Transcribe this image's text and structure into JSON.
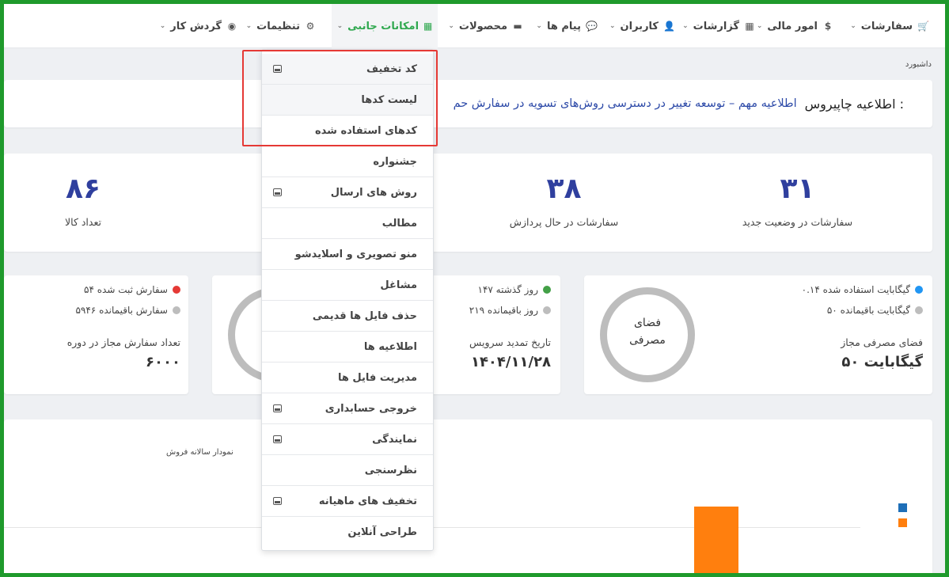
{
  "nav": {
    "items": [
      {
        "label": "سفارشات",
        "icon": "cart-icon",
        "glyph": "🛒"
      },
      {
        "label": "امور مالی",
        "icon": "dollar-icon",
        "glyph": "$"
      },
      {
        "label": "گزارشات",
        "icon": "bar-chart-icon",
        "glyph": "▦"
      },
      {
        "label": "کاربران",
        "icon": "user-icon",
        "glyph": "👤"
      },
      {
        "label": "پیام ها",
        "icon": "message-icon",
        "glyph": "💬"
      },
      {
        "label": "محصولات",
        "icon": "store-icon",
        "glyph": "▬"
      },
      {
        "label": "امکانات جانبی",
        "icon": "grid-icon",
        "glyph": "▦"
      },
      {
        "label": "تنظیمات",
        "icon": "gear-icon",
        "glyph": "⚙"
      },
      {
        "label": "گردش کار",
        "icon": "workflow-icon",
        "glyph": "◉"
      }
    ],
    "chevron": "⌄",
    "active_index": 6
  },
  "breadcrumb": "داشبورد",
  "announcement": {
    "label": "اطلاعیه چاپیروس :",
    "link": "اطلاعیه مهم – توسعه تغییر در دسترسی روش‌های تسویه در سفارش حم"
  },
  "stats": [
    {
      "value": "۳۱",
      "label": "سفارشات در وضعیت جدید"
    },
    {
      "value": "۳۸",
      "label": "سفارشات در حال پردازش"
    },
    {
      "value": "۸۶",
      "label": "تعداد کالا"
    }
  ],
  "storage": {
    "used": "۰.۱۴ گیگابایت استفاده شده",
    "remaining": "۵۰ گیگابایت باقیمانده",
    "allowed_label": "فضای مصرفی مجاز",
    "allowed_value": "۵۰ گیگابایت",
    "ring_line1": "فضای",
    "ring_line2": "مصرفی",
    "used_color": "#2196f3",
    "remaining_color": "#bdbdbd"
  },
  "service": {
    "passed": "۱۴۷ روز گذشته",
    "remaining": "۲۱۹ روز باقیمانده",
    "renew_label": "تاریخ تمدید سرویس",
    "renew_value": "۱۴۰۴/۱۱/۲۸",
    "passed_color": "#43a047"
  },
  "orders_quota": {
    "registered": "۵۴ سفارش ثبت شده",
    "remaining": "۵۹۴۶ سفارش باقیمانده",
    "allowed_label": "تعداد سفارش مجاز در دوره",
    "allowed_value": "۶۰۰۰",
    "registered_color": "#e53935"
  },
  "chart": {
    "title": "نمودار سالانه فروش",
    "series_colors": [
      "#1e6fb8",
      "#ff7f0e"
    ]
  },
  "dropdown": {
    "items": [
      {
        "label": "کد تخفیف",
        "icon": true,
        "shaded": true
      },
      {
        "label": "لیست کدها",
        "icon": false,
        "shaded": true
      },
      {
        "label": "کدهای استفاده شده",
        "icon": false,
        "shaded": false
      },
      {
        "label": "جشنواره",
        "icon": false,
        "shaded": false
      },
      {
        "label": "روش های ارسال",
        "icon": true,
        "shaded": false
      },
      {
        "label": "مطالب",
        "icon": false,
        "shaded": false
      },
      {
        "label": "منو تصویری و اسلایدشو",
        "icon": false,
        "shaded": false
      },
      {
        "label": "مشاغل",
        "icon": false,
        "shaded": false
      },
      {
        "label": "حذف فایل ها قدیمی",
        "icon": false,
        "shaded": false
      },
      {
        "label": "اطلاعیه ها",
        "icon": false,
        "shaded": false
      },
      {
        "label": "مدیریت فایل ها",
        "icon": false,
        "shaded": false
      },
      {
        "label": "خروجی حسابداری",
        "icon": true,
        "shaded": false
      },
      {
        "label": "نمایندگی",
        "icon": true,
        "shaded": false
      },
      {
        "label": "نظرسنجی",
        "icon": false,
        "shaded": false
      },
      {
        "label": "تخفیف های ماهیانه",
        "icon": true,
        "shaded": false
      },
      {
        "label": "طراحی آنلاین",
        "icon": false,
        "shaded": false
      }
    ]
  },
  "colors": {
    "accent": "#2fa84f",
    "stat_number": "#2f3f9e",
    "frame": "#1f9a2c",
    "highlight": "#e53935"
  }
}
